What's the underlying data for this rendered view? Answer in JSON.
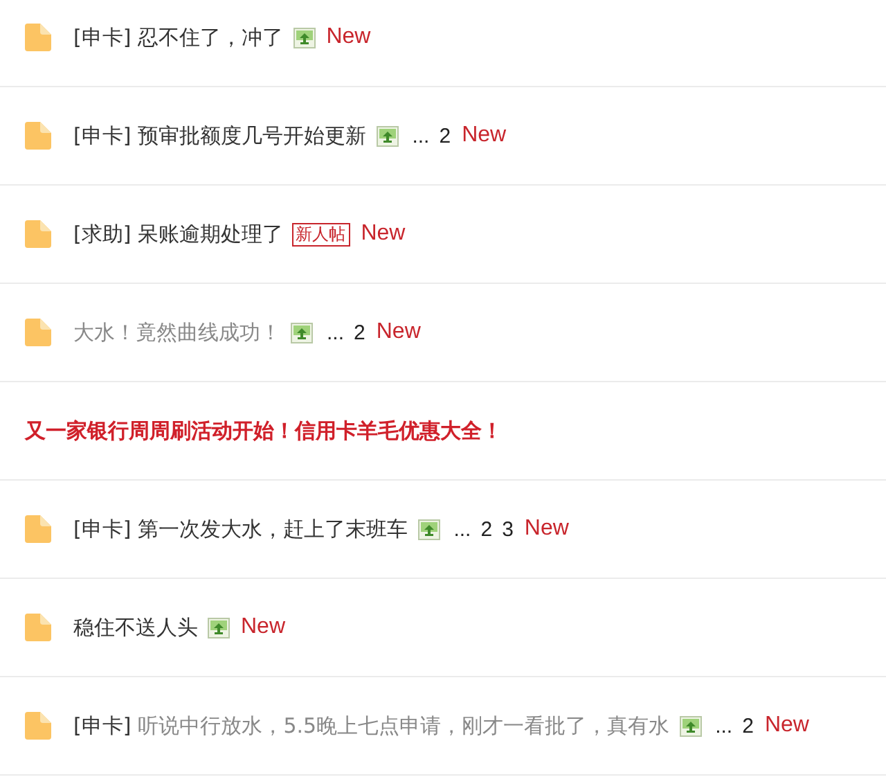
{
  "threads": [
    {
      "kind": "thread",
      "prefix": "[申卡]",
      "title": "忍不住了，冲了",
      "visited": false,
      "attachment": true,
      "new_label": "New"
    },
    {
      "kind": "thread",
      "prefix": "[申卡]",
      "title": "预审批额度几号开始更新",
      "visited": false,
      "attachment": true,
      "ellipsis": "...",
      "pages": [
        "2"
      ],
      "new_label": "New"
    },
    {
      "kind": "thread",
      "prefix": "[求助]",
      "title": "呆账逾期处理了",
      "visited": false,
      "attachment": false,
      "badge": "新人帖",
      "new_label": "New"
    },
    {
      "kind": "thread",
      "title": "大水！竟然曲线成功！",
      "visited": true,
      "attachment": true,
      "ellipsis": "...",
      "pages": [
        "2"
      ],
      "new_label": "New"
    },
    {
      "kind": "headline",
      "title": "又一家银行周周刷活动开始！信用卡羊毛优惠大全！"
    },
    {
      "kind": "thread",
      "prefix": "[申卡]",
      "title": "第一次发大水，赶上了末班车",
      "visited": false,
      "attachment": true,
      "ellipsis": "...",
      "pages": [
        "2",
        "3"
      ],
      "new_label": "New"
    },
    {
      "kind": "thread",
      "title": "稳住不送人头",
      "visited": false,
      "attachment": true,
      "new_label": "New"
    },
    {
      "kind": "thread",
      "prefix": "[申卡]",
      "title": "听说中行放水，5.5晚上七点申请，刚才一看批了，真有水",
      "visited": true,
      "attachment": true,
      "ellipsis": "...",
      "pages": [
        "2"
      ],
      "new_label": "New"
    }
  ]
}
